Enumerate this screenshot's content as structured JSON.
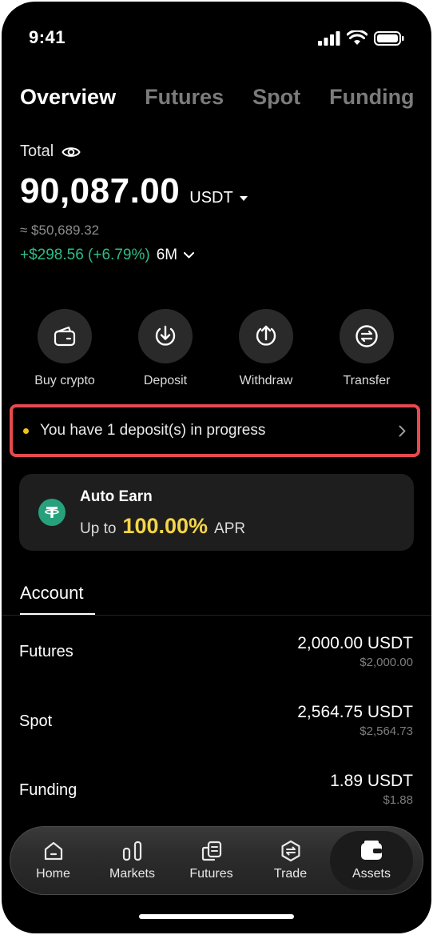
{
  "status_bar": {
    "time": "9:41"
  },
  "tabs": [
    {
      "label": "Overview",
      "active": true
    },
    {
      "label": "Futures",
      "active": false
    },
    {
      "label": "Spot",
      "active": false
    },
    {
      "label": "Funding",
      "active": false
    }
  ],
  "summary": {
    "total_label": "Total",
    "balance": "90,087.00",
    "unit": "USDT",
    "approx": "≈ $50,689.32",
    "pnl": "+$298.56 (+6.79%)",
    "period": "6M"
  },
  "actions": [
    {
      "label": "Buy crypto",
      "icon": "wallet-icon"
    },
    {
      "label": "Deposit",
      "icon": "deposit-icon"
    },
    {
      "label": "Withdraw",
      "icon": "withdraw-icon"
    },
    {
      "label": "Transfer",
      "icon": "transfer-icon"
    }
  ],
  "banner": {
    "text": "You have 1 deposit(s) in progress"
  },
  "auto_earn": {
    "title": "Auto Earn",
    "prefix": "Up to",
    "rate": "100.00%",
    "suffix": "APR"
  },
  "account": {
    "tab_label": "Account",
    "rows": [
      {
        "name": "Futures",
        "amount": "2,000.00 USDT",
        "fiat": "$2,000.00"
      },
      {
        "name": "Spot",
        "amount": "2,564.75 USDT",
        "fiat": "$2,564.73"
      },
      {
        "name": "Funding",
        "amount": "1.89 USDT",
        "fiat": "$1.88"
      }
    ]
  },
  "nav": [
    {
      "label": "Home",
      "icon": "home-icon",
      "active": false
    },
    {
      "label": "Markets",
      "icon": "markets-icon",
      "active": false
    },
    {
      "label": "Futures",
      "icon": "futures-icon",
      "active": false
    },
    {
      "label": "Trade",
      "icon": "trade-icon",
      "active": false
    },
    {
      "label": "Assets",
      "icon": "assets-icon",
      "active": true
    }
  ],
  "colors": {
    "positive": "#2ebd85",
    "highlight": "#f5d547",
    "banner_border": "#e64a4f",
    "tether": "#26a17b"
  }
}
